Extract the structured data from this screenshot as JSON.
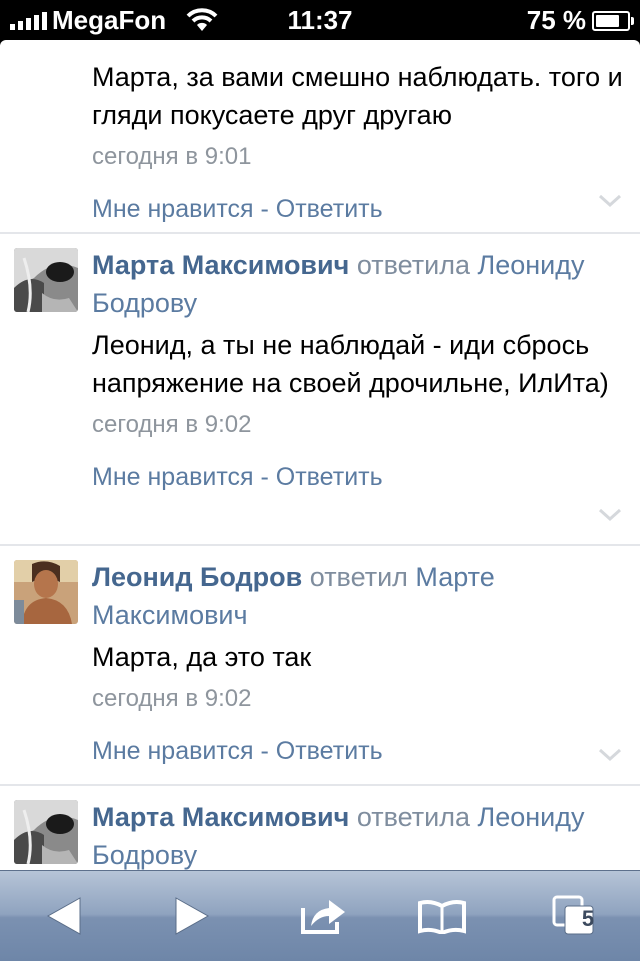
{
  "status_bar": {
    "carrier": "MegaFon",
    "time": "11:37",
    "battery": "75 %",
    "battery_level": 0.75
  },
  "comments": [
    {
      "text": "Марта, за вами смешно наблюдать. того и гляди покусаете друг другаю",
      "time": "сегодня в 9:01",
      "like": "Мне нравится",
      "separator": " - ",
      "reply": "Ответить"
    },
    {
      "author": "Марта Максимович",
      "verb": " ответила ",
      "target": "Леониду Бодрову",
      "text": "Леонид, а ты не наблюдай - иди сбрось напряжение на своей дрочильне, ИлИта)",
      "time": "сегодня в 9:02",
      "like": "Мне нравится",
      "separator": " - ",
      "reply": "Ответить"
    },
    {
      "author": "Леонид Бодров",
      "verb": " ответил ",
      "target": "Марте Максимович",
      "text": "Марта, да это так",
      "time": "сегодня в 9:02",
      "like": "Мне нравится",
      "separator": " - ",
      "reply": "Ответить"
    },
    {
      "author": "Марта Максимович",
      "verb": " ответила ",
      "target": "Леониду Бодрову"
    }
  ],
  "toolbar": {
    "tabs_count": "5",
    "icons": [
      "back-icon",
      "forward-icon",
      "share-icon",
      "bookmarks-icon",
      "tabs-icon"
    ]
  },
  "colors": {
    "author": "#45678f",
    "link": "#5b7ba1",
    "meta": "#8e959d"
  }
}
